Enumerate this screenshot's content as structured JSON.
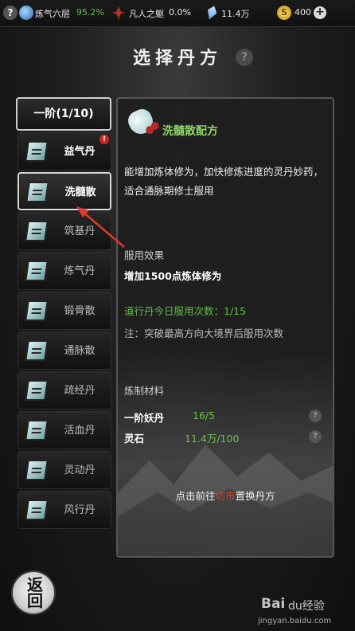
{
  "topbar": {
    "realm_label": "炼气六层",
    "realm_progress": "95.2%",
    "body_label": "凡人之躯",
    "body_progress": "0.0%",
    "spirit_stones": "11.4万",
    "gold": "400",
    "help_glyph": "?",
    "plus_glyph": "+"
  },
  "page": {
    "title": "选择丹方",
    "title_help": "?"
  },
  "tier_tab": "一阶(1/10)",
  "recipes": [
    {
      "name": "益气丹",
      "alert": "!"
    },
    {
      "name": "洗髓散"
    },
    {
      "name": "筑基丹"
    },
    {
      "name": "炼气丹"
    },
    {
      "name": "锻骨散"
    },
    {
      "name": "通脉散"
    },
    {
      "name": "疏经丹"
    },
    {
      "name": "活血丹"
    },
    {
      "name": "灵动丹"
    },
    {
      "name": "风行丹"
    }
  ],
  "detail": {
    "title": "洗髓散配方",
    "description": "能增加炼体修为，加快修炼进度的灵丹妙药，适合通脉期修士服用",
    "effect_heading": "服用效果",
    "effect": "增加1500点炼体修为",
    "usage": "道行丹今日服用次数：1/15",
    "note": "注：突破最高方向大境界后服用次数",
    "materials_heading": "炼制材料",
    "materials": [
      {
        "name": "一阶妖丹",
        "qty": "16/5"
      },
      {
        "name": "灵石",
        "qty": "11.4万/100"
      }
    ],
    "hint_before": "点击前往",
    "hint_shop": "坊市",
    "hint_after": "置换丹方"
  },
  "back_button": {
    "line1": "返",
    "line2": "回"
  },
  "watermark": {
    "main": "Bai",
    "paw": "du经验",
    "sub": "jingyan.baidu.com"
  },
  "colors": {
    "accent_green": "#5fbf4a",
    "title_green": "#8fd36a",
    "shop_red": "#d6422f",
    "alert_red": "#d0261d",
    "arrow_red": "#e03a2c"
  }
}
